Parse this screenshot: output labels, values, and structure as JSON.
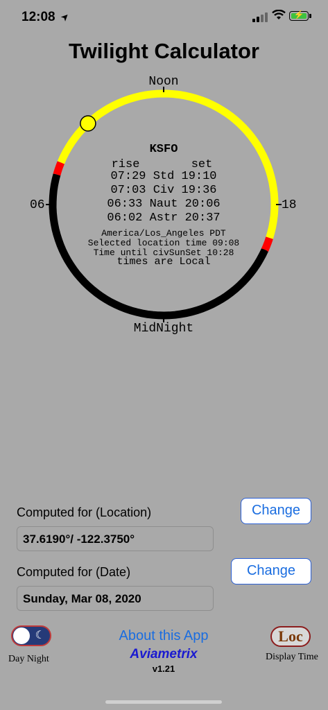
{
  "status": {
    "time": "12:08",
    "location_arrow": "➤"
  },
  "title": "Twilight Calculator",
  "clock": {
    "top_label": "Noon",
    "bottom_label": "MidNight",
    "left_label": "06",
    "right_label": "18",
    "station": "KSFO",
    "rise_header": "rise",
    "set_header": "set",
    "rows": [
      {
        "rise": "07:29",
        "type": "Std",
        "set": "19:10"
      },
      {
        "rise": "07:03",
        "type": "Civ",
        "set": "19:36"
      },
      {
        "rise": "06:33",
        "type": "Naut",
        "set": "20:06"
      },
      {
        "rise": "06:02",
        "type": "Astr",
        "set": "20:37"
      }
    ],
    "timezone": "America/Los_Angeles PDT",
    "selected_time": "Selected location time 09:08",
    "time_until": "Time until civSunSet 10:28",
    "times_note": "times are Local",
    "colors": {
      "day": "#ffff00",
      "twilight": "#ff0000",
      "night": "#000000",
      "sun": "#ffff00"
    }
  },
  "location": {
    "label": "Computed for (Location)",
    "value": "37.6190°/ -122.3750°",
    "button": "Change"
  },
  "date": {
    "label": "Computed for (Date)",
    "value": "Sunday, Mar 08, 2020",
    "button": "Change"
  },
  "footer": {
    "daynight_label": "Day Night",
    "about": "About this App",
    "brand": "Aviametrix",
    "version": "v1.21",
    "loc_button": "Loc",
    "display_time_label": "Display Time"
  }
}
